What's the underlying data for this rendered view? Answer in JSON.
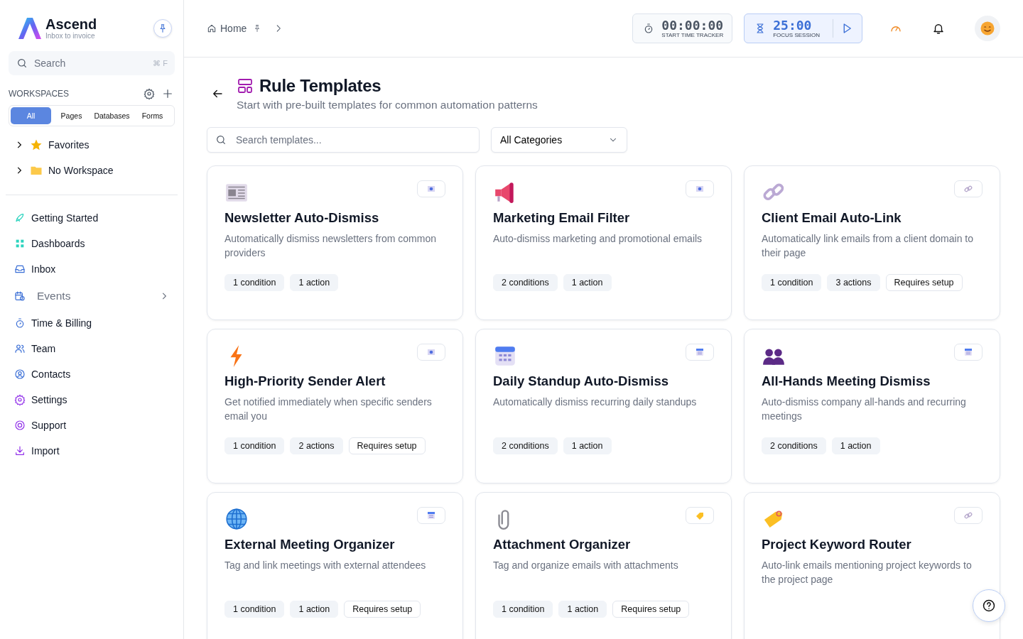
{
  "brand": {
    "name": "Ascend",
    "tagline": "Inbox to invoice"
  },
  "sidebar": {
    "search": {
      "placeholder": "Search",
      "shortcut": "⌘ F"
    },
    "workspaces": {
      "heading": "WORKSPACES",
      "tabs": [
        {
          "label": "All",
          "selected": true
        },
        {
          "label": "Pages",
          "selected": false
        },
        {
          "label": "Databases",
          "selected": false
        },
        {
          "label": "Forms",
          "selected": false
        }
      ],
      "groups": [
        {
          "label": "Favorites",
          "kind": "star",
          "expanded": false
        },
        {
          "label": "No Workspace",
          "kind": "folder",
          "expanded": false
        }
      ]
    },
    "items": [
      {
        "label": "Getting Started",
        "kind": "rocket",
        "has_submenu": false
      },
      {
        "label": "Dashboards",
        "kind": "grid",
        "has_submenu": false
      },
      {
        "label": "Inbox",
        "kind": "inbox",
        "has_submenu": false
      },
      {
        "label": "Events",
        "kind": "calendar",
        "has_submenu": true
      },
      {
        "label": "Time & Billing",
        "kind": "stopwatch",
        "has_submenu": false
      },
      {
        "label": "Team",
        "kind": "team",
        "has_submenu": false
      },
      {
        "label": "Contacts",
        "kind": "contact",
        "has_submenu": false
      },
      {
        "label": "Settings",
        "kind": "gear",
        "has_submenu": false
      },
      {
        "label": "Support",
        "kind": "lifebuoy",
        "has_submenu": false
      },
      {
        "label": "Import",
        "kind": "download",
        "has_submenu": false
      }
    ]
  },
  "breadcrumb": {
    "label": "Home"
  },
  "time_tracker": {
    "time": "00:00:00",
    "label": "START TIME TRACKER"
  },
  "focus_session": {
    "time": "25:00",
    "label": "FOCUS SESSION"
  },
  "page": {
    "title": "Rule Templates",
    "subtitle": "Start with pre-built templates for common automation patterns",
    "search": {
      "placeholder": "Search templates..."
    },
    "category": {
      "value": "All Categories"
    }
  },
  "templates": [
    {
      "kind": "newspaper",
      "category": {
        "kind": "email"
      },
      "title": "Newsletter Auto-Dismiss",
      "description": "Automatically dismiss newsletters from common providers",
      "tags": [
        {
          "label": "1 condition",
          "kind": "count"
        },
        {
          "label": "1 action",
          "kind": "count"
        }
      ]
    },
    {
      "kind": "megaphone",
      "category": {
        "kind": "email"
      },
      "title": "Marketing Email Filter",
      "description": "Auto-dismiss marketing and promotional emails",
      "tags": [
        {
          "label": "2 conditions",
          "kind": "count"
        },
        {
          "label": "1 action",
          "kind": "count"
        }
      ]
    },
    {
      "kind": "chain",
      "category": {
        "kind": "link"
      },
      "title": "Client Email Auto-Link",
      "description": "Automatically link emails from a client domain to their page",
      "tags": [
        {
          "label": "1 condition",
          "kind": "count"
        },
        {
          "label": "3 actions",
          "kind": "count"
        },
        {
          "label": "Requires setup",
          "kind": "setup"
        }
      ]
    },
    {
      "kind": "bolt",
      "category": {
        "kind": "email"
      },
      "title": "High-Priority Sender Alert",
      "description": "Get notified immediately when specific senders email you",
      "tags": [
        {
          "label": "1 condition",
          "kind": "count"
        },
        {
          "label": "2 actions",
          "kind": "count"
        },
        {
          "label": "Requires setup",
          "kind": "setup"
        }
      ]
    },
    {
      "kind": "calendar",
      "category": {
        "kind": "calendar"
      },
      "title": "Daily Standup Auto-Dismiss",
      "description": "Automatically dismiss recurring daily standups",
      "tags": [
        {
          "label": "2 conditions",
          "kind": "count"
        },
        {
          "label": "1 action",
          "kind": "count"
        }
      ]
    },
    {
      "kind": "people",
      "category": {
        "kind": "calendar"
      },
      "title": "All-Hands Meeting Dismiss",
      "description": "Auto-dismiss company all-hands and recurring meetings",
      "tags": [
        {
          "label": "2 conditions",
          "kind": "count"
        },
        {
          "label": "1 action",
          "kind": "count"
        }
      ]
    },
    {
      "kind": "globe",
      "category": {
        "kind": "calendar"
      },
      "title": "External Meeting Organizer",
      "description": "Tag and link meetings with external attendees",
      "tags": [
        {
          "label": "1 condition",
          "kind": "count"
        },
        {
          "label": "1 action",
          "kind": "count"
        },
        {
          "label": "Requires setup",
          "kind": "setup"
        }
      ]
    },
    {
      "kind": "paperclip",
      "category": {
        "kind": "tag"
      },
      "title": "Attachment Organizer",
      "description": "Tag and organize emails with attachments",
      "tags": [
        {
          "label": "1 condition",
          "kind": "count"
        },
        {
          "label": "1 action",
          "kind": "count"
        },
        {
          "label": "Requires setup",
          "kind": "setup"
        }
      ]
    },
    {
      "kind": "tag",
      "category": {
        "kind": "link"
      },
      "title": "Project Keyword Router",
      "description": "Auto-link emails mentioning project keywords to the project page"
    }
  ]
}
